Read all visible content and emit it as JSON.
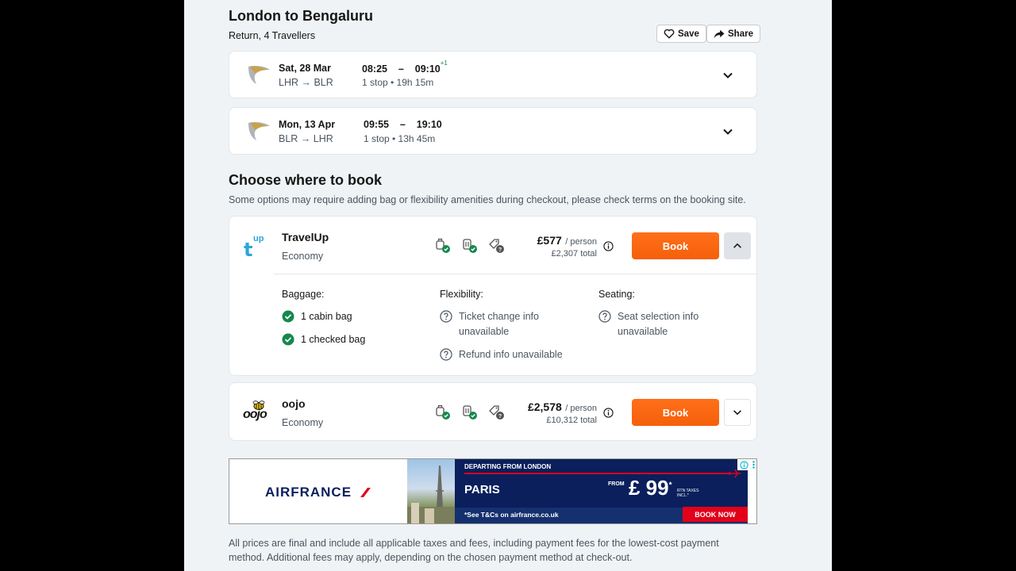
{
  "trip": {
    "title": "London to Bengaluru",
    "subtitle": "Return, 4 Travellers",
    "save_label": "Save",
    "share_label": "Share"
  },
  "legs": [
    {
      "date": "Sat, 28 Mar",
      "route_from": "LHR",
      "route_to": "BLR",
      "depart": "08:25",
      "dash": "–",
      "arrive": "09:10",
      "day_offset": "+1",
      "info": "1 stop • 19h 15m"
    },
    {
      "date": "Mon, 13 Apr",
      "route_from": "BLR",
      "route_to": "LHR",
      "depart": "09:55",
      "dash": "–",
      "arrive": "19:10",
      "day_offset": "",
      "info": "1 stop • 13h 45m"
    }
  ],
  "booking": {
    "heading": "Choose where to book",
    "note": "Some options may require adding bag or flexibility amenities during checkout, please check terms on the booking site.",
    "providers": [
      {
        "name": "TravelUp",
        "logo_text": "t",
        "logo_sup": "up",
        "cabin": "Economy",
        "price": "£577",
        "per": "/ person",
        "total": "£2,307 total",
        "book_label": "Book",
        "expanded": true,
        "details": {
          "baggage_heading": "Baggage:",
          "baggage": [
            "1 cabin bag",
            "1 checked bag"
          ],
          "flex_heading": "Flexibility:",
          "flex_line1": "Ticket change info",
          "flex_line2": "unavailable",
          "refund": "Refund info unavailable",
          "seat_heading": "Seating:",
          "seat_line1": "Seat selection info",
          "seat_line2": "unavailable"
        }
      },
      {
        "name": "oojo",
        "logo_text": "oojo",
        "cabin": "Economy",
        "price": "£2,578",
        "per": "/ person",
        "total": "£10,312 total",
        "book_label": "Book",
        "expanded": false
      }
    ]
  },
  "ad": {
    "brand": "AIRFRANCE",
    "departing": "DEPARTING FROM LONDON",
    "city": "PARIS",
    "from_label": "FROM",
    "price": "£ 99",
    "price_star": "*",
    "price_note": "RTN TAXES INCL.*",
    "terms": "*See T&Cs on airfrance.co.uk",
    "cta": "BOOK NOW"
  },
  "footer": {
    "text": "All prices are final and include all applicable taxes and fees, including payment fees for the lowest-cost payment method. Additional fees may apply, depending on the chosen payment method at check-out."
  },
  "colors": {
    "book": "#ff690f",
    "check": "#14884c",
    "page_bg": "#f0f3f5",
    "ad_navy": "#0a1f5c",
    "ad_red": "#e2001a"
  }
}
